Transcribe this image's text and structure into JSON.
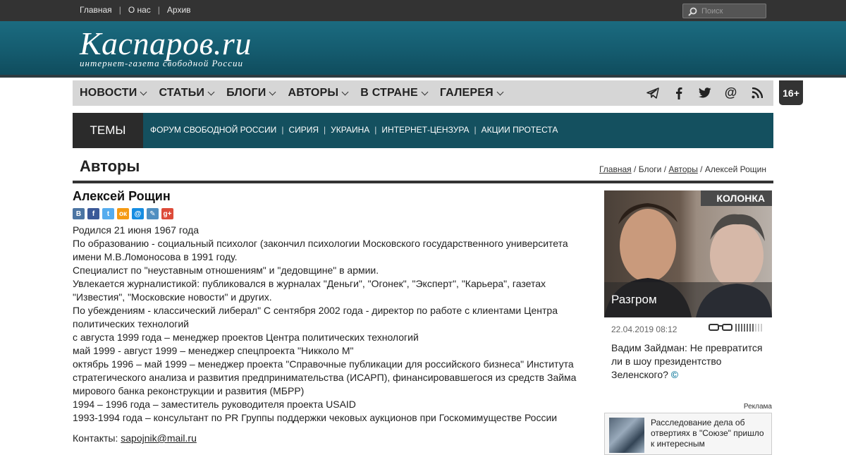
{
  "topnav": {
    "items": [
      "Главная",
      "О нас",
      "Архив"
    ],
    "search_placeholder": "Поиск"
  },
  "logo": {
    "main": "Каспаров.ru",
    "sub": "интернет-газета свободной России"
  },
  "menu": {
    "items": [
      "НОВОСТИ",
      "СТАТЬИ",
      "БЛОГИ",
      "АВТОРЫ",
      "В СТРАНЕ",
      "ГАЛЕРЕЯ"
    ]
  },
  "age_badge": "16+",
  "themes": {
    "label": "ТЕМЫ",
    "items": [
      "ФОРУМ СВОБОДНОЙ РОССИИ",
      "СИРИЯ",
      "УКРАИНА",
      "ИНТЕРНЕТ-ЦЕНЗУРА",
      "АКЦИИ ПРОТЕСТА"
    ]
  },
  "page": {
    "title": "Авторы"
  },
  "breadcrumb": {
    "home": "Главная",
    "blogs": "Блоги",
    "authors": "Авторы",
    "current": "Алексей Рощин",
    "sep": "/"
  },
  "author": {
    "name": "Алексей Рощин",
    "bio": [
      "Родился 21 июня 1967 года",
      "По образованию - социальный психолог (закончил психологии Московского государственного университета имени М.В.Ломоносова в 1991 году.",
      "Специалист по \"неуставным отношениям\" и \"дедовщине\" в армии.",
      "Увлекается журналистикой: публиковался в журналах \"Деньги\", \"Огонек\", \"Эксперт\", \"Карьера\", газетах \"Известия\", \"Московские новости\" и других.",
      "По убеждениям - классический либерал\" С сентября 2002 года - директор по работе с клиентами Центра политических технологий",
      "с августа 1999 года – менеджер проектов Центра политических технологий",
      "май 1999 - август 1999 – менеджер спецпроекта \"Никколо М\"",
      "октябрь 1996 – май 1999 – менеджер проекта \"Справочные публикации для российского бизнеса\" Института стратегического анализа и развития предпринимательства (ИСАРП), финансировавшегося из средств Займа мирового банка реконструкции и развития (МБРР)",
      "1994 – 1996 года – заместитель руководителя проекта USAID",
      "1993-1994 года – консультант по PR Группы поддержки чековых аукционов при Госкомимуществе России"
    ],
    "contacts_label": "Контакты:",
    "email": "sapojnik@mail.ru"
  },
  "share_icons": [
    {
      "name": "vk-icon",
      "glyph": "В",
      "color": "#4c75a3"
    },
    {
      "name": "facebook-icon",
      "glyph": "f",
      "color": "#3b5998"
    },
    {
      "name": "twitter-icon",
      "glyph": "t",
      "color": "#55acee"
    },
    {
      "name": "odnoklassniki-icon",
      "glyph": "ок",
      "color": "#f59a12"
    },
    {
      "name": "mailru-icon",
      "glyph": "@",
      "color": "#168de2"
    },
    {
      "name": "livejournal-icon",
      "glyph": "✎",
      "color": "#4f8fc1"
    },
    {
      "name": "googleplus-icon",
      "glyph": "g+",
      "color": "#dd4b39"
    }
  ],
  "column": {
    "badge": "КОЛОНКА",
    "caption": "Разгром",
    "date": "22.04.2019 08:12",
    "title": "Вадим Зайдман: Не превратится ли в шоу президентство Зеленского?",
    "copyright": "©"
  },
  "ad": {
    "label": "Реклама",
    "text": "Расследование дела об отвертиях в \"Союзе\" пришло к интересным"
  },
  "colors": {
    "header": "#145a6d",
    "themes": "#14505f",
    "menu": "#d6d6d6",
    "topbar": "#333333"
  }
}
